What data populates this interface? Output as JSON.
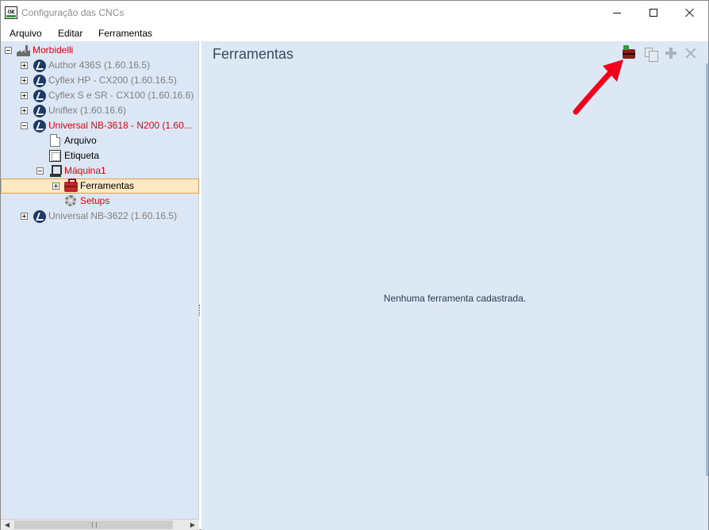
{
  "window": {
    "title": "Configuração das CNCs",
    "icon_text": "CNC"
  },
  "menu": {
    "items": [
      "Arquivo",
      "Editar",
      "Ferramentas"
    ]
  },
  "tree": {
    "root": "Morbidelli",
    "nodes": [
      "Author 436S (1.60.16.5)",
      "Cyflex HP - CX200 (1.60.16.5)",
      "Cyflex S e SR - CX100 (1.60.16.6)",
      "Uniflex (1.60.16.6)",
      "Universal NB-3618 - N200 (1.60...",
      "Arquivo",
      "Etiqueta",
      "Máquina1",
      "Ferramentas",
      "Setups",
      "Universal NB-3622 (1.60.16.5)"
    ]
  },
  "content": {
    "title": "Ferramentas",
    "empty_message": "Nenhuma ferramenta cadastrada."
  },
  "colors": {
    "active_red": "#e8000b",
    "tree_background": "#dce7f6",
    "content_background": "#dde8f5",
    "selection_background": "#fde8c4",
    "selection_border": "#e8a04a",
    "annotation_arrow": "#f0001c"
  },
  "icons": {
    "toolbar": [
      "new-tool-icon",
      "copy-icon",
      "plus-icon",
      "x-icon"
    ]
  }
}
